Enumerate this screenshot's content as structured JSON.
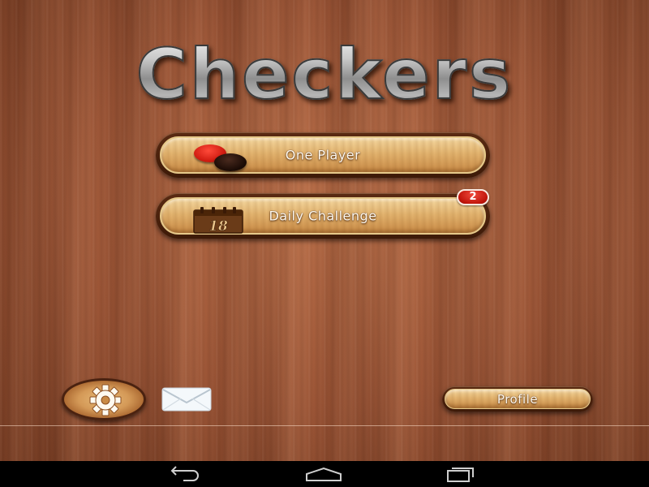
{
  "app": {
    "title": "Checkers"
  },
  "menu": {
    "one_player_label": "One Player",
    "daily_challenge_label": "Daily Challenge",
    "daily_challenge_badge": "2",
    "calendar_day": "18"
  },
  "footer": {
    "profile_label": "Profile",
    "settings_icon": "gear-icon",
    "mail_icon": "envelope-icon"
  },
  "system_nav": {
    "back_icon": "back-icon",
    "home_icon": "home-icon",
    "recent_icon": "recent-apps-icon"
  },
  "colors": {
    "wood_background": "#9c5536",
    "button_face": "#e3b46f",
    "button_rim": "#3d1a08",
    "badge_red": "#c1150b",
    "red_piece": "#d21d12",
    "black_piece": "#1c0c06",
    "title_metal": "#9a9a9a"
  }
}
